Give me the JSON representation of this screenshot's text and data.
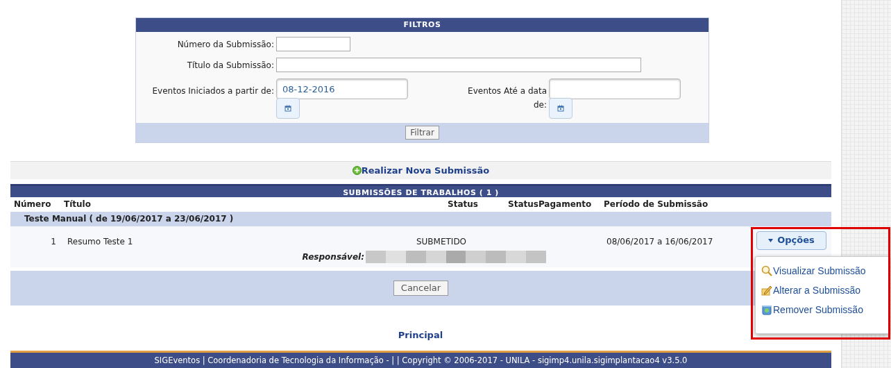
{
  "filters": {
    "title": "FILTROS",
    "text_fields": [
      {
        "label": "Número da Submissão:"
      },
      {
        "label": "Título da Submissão:"
      }
    ],
    "date_fields": [
      {
        "label": "Eventos Iniciados a partir de:",
        "value": "08-12-2016"
      },
      {
        "label": "Eventos Até a data de:"
      }
    ],
    "button": "Filtrar"
  },
  "new_submission_link": "Realizar Nova Submissão",
  "submissions": {
    "title": "SUBMISSÕES DE TRABALHOS ( 1 )",
    "columns": [
      "Número",
      "Título",
      "Status",
      "StatusPagamento",
      "Período de Submissão"
    ],
    "groups": [
      {
        "title": "Teste Manual ( de 19/06/2017 a 23/06/2017 )",
        "rows": [
          {
            "number": "1",
            "title": "Resumo Teste 1",
            "status": "SUBMETIDO",
            "period": "08/06/2017 a 16/06/2017",
            "responsible_label": "Responsável:",
            "options_button": "Opções"
          }
        ]
      }
    ],
    "button": "Cancelar"
  },
  "options_menu": {
    "expanded": true,
    "items": [
      {
        "label": "Visualizar Submissão",
        "kind": "view"
      },
      {
        "label": "Alterar a Submissão",
        "kind": "edit"
      },
      {
        "label": "Remover Submissão",
        "kind": "remove"
      }
    ]
  },
  "principal_link": "Principal",
  "footer": "SIGEventos | Coordenadoria de Tecnologia da Informação - | | Copyright © 2006-2017 - UNILA - sigimp4.unila.sigimplantacao4 v3.5.0"
}
